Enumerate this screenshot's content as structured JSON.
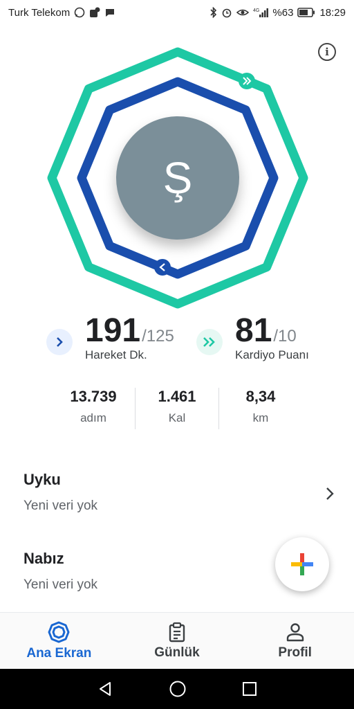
{
  "status_bar": {
    "carrier": "Turk Telekom",
    "battery_percent": "%63",
    "time": "18:29",
    "network": "4G"
  },
  "rings": {
    "outer_color": "#1ec8a4",
    "inner_color": "#1a4ead",
    "outer_progress": 1.0,
    "inner_progress": 1.0
  },
  "avatar": {
    "letter": "Ş",
    "color": "#7b8f99"
  },
  "move_minutes": {
    "value": "191",
    "goal": "/125",
    "label": "Hareket Dk."
  },
  "heart_points": {
    "value": "81",
    "goal": "/10",
    "label": "Kardiyo Puanı"
  },
  "stats": [
    {
      "value": "13.739",
      "unit": "adım"
    },
    {
      "value": "1.461",
      "unit": "Kal"
    },
    {
      "value": "8,34",
      "unit": "km"
    }
  ],
  "cards": [
    {
      "title": "Uyku",
      "subtitle": "Yeni veri yok"
    },
    {
      "title": "Nabız",
      "subtitle": "Yeni veri yok"
    }
  ],
  "bottom_nav": [
    {
      "label": "Ana Ekran",
      "icon": "home-ring-icon",
      "active": true
    },
    {
      "label": "Günlük",
      "icon": "journal-icon",
      "active": false
    },
    {
      "label": "Profil",
      "icon": "profile-icon",
      "active": false
    }
  ],
  "fab": {
    "icon": "google-plus-icon"
  },
  "info": {
    "glyph": "i"
  }
}
